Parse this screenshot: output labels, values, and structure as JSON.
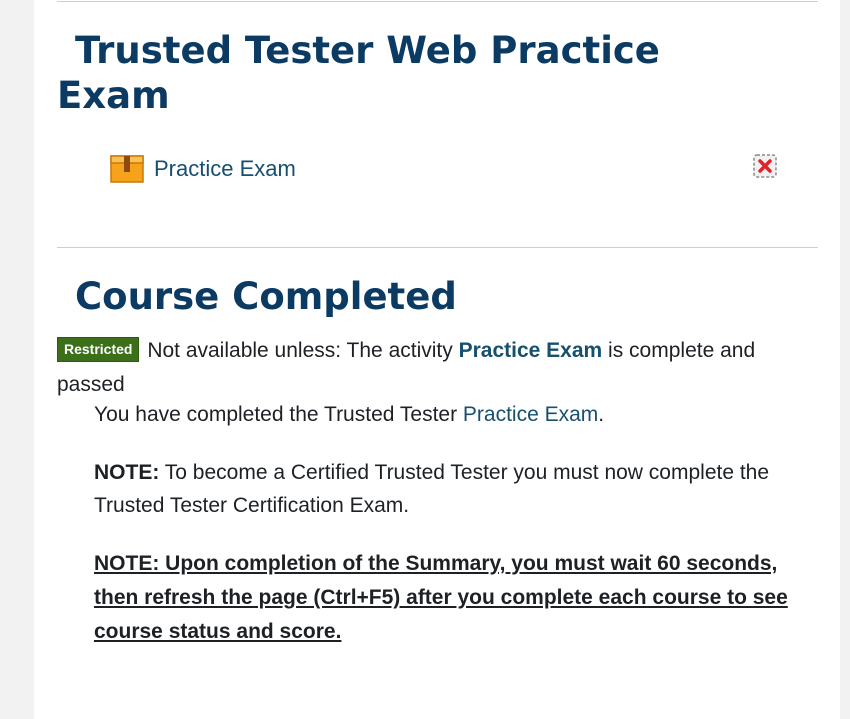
{
  "section1": {
    "title_line1": "Trusted Tester Web Practice",
    "title_line2": "Exam",
    "activity": {
      "name": "Practice Exam",
      "icon": "package-icon",
      "action_icon": "remove-icon"
    }
  },
  "section2": {
    "title": "Course Completed",
    "restriction": {
      "badge": "Restricted",
      "prefix": "Not available unless: The activity",
      "activity_name": "Practice Exam",
      "suffix": "is complete and passed"
    },
    "summary": {
      "p1_prefix": "You have completed the Trusted Tester",
      "p1_link": "Practice Exam",
      "p1_suffix": ".",
      "note1_label": "NOTE:",
      "note1_text": "To become a Certified Trusted Tester you must now complete the Trusted Tester Certification Exam.",
      "note2": "NOTE: Upon completion of the Summary, you must wait 60 seconds, then refresh the page (Ctrl+F5) after you complete each course to see course status and score."
    }
  },
  "colors": {
    "heading": "#0b3a63",
    "link": "#174f6e",
    "badge_bg": "#3c6f1a",
    "page_bg": "#f2f2f2"
  }
}
